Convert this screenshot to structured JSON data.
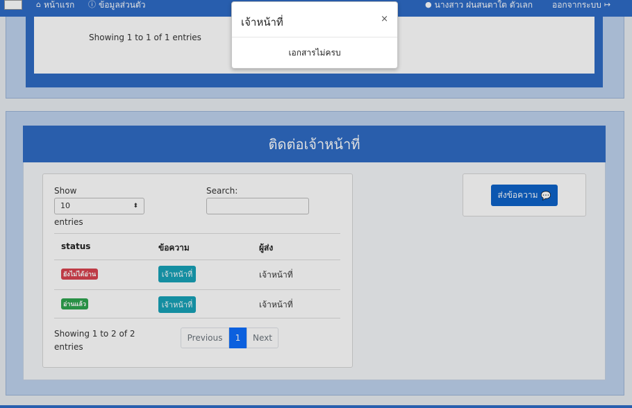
{
  "navbar": {
    "home_label": "หน้าแรก",
    "profile_label": "ข้อมูลส่วนตัว",
    "user_name": "นางสาว ฝนสนตาใต ตัวเลก",
    "logout_label": "ออกจากระบบ"
  },
  "top_panel": {
    "info": "Showing 1 to 1 of 1 entries"
  },
  "main": {
    "title": "ติดต่อเจ้าหน้าที่",
    "length": {
      "show_label": "Show",
      "value": "10",
      "entries_label": "entries"
    },
    "search_label": "Search:",
    "columns": [
      "status",
      "ข้อความ",
      "ผู้ส่ง"
    ],
    "rows": [
      {
        "status": "ยังไม่ได้อ่าน",
        "status_color": "#d9434f",
        "message": "เจ้าหน้าที่",
        "sender": "เจ้าหน้าที่"
      },
      {
        "status": "อ่านแล้ว",
        "status_color": "#2ea44f",
        "message": "เจ้าหน้าที่",
        "sender": "เจ้าหน้าที่"
      }
    ],
    "info_line1": "Showing 1 to 2 of 2",
    "info_line2": "entries",
    "pagination": {
      "previous": "Previous",
      "current": "1",
      "next": "Next"
    },
    "send_button": "ส่งข้อความ"
  },
  "modal": {
    "title": "เจ้าหน้าที่",
    "close": "×",
    "body": "เอกสารไม่ครบ"
  },
  "colors": {
    "primary": "#2f6cc4",
    "button": "#0d62c9",
    "teal": "#17a2b8"
  }
}
